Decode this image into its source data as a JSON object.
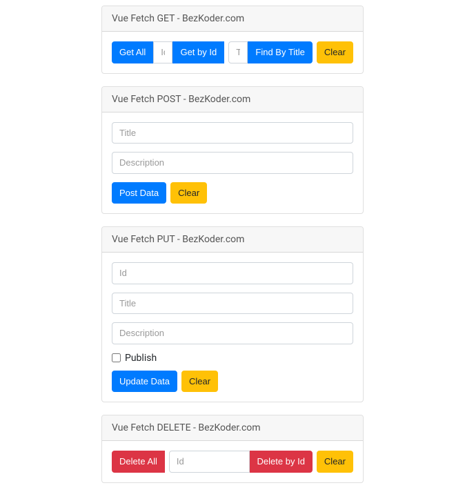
{
  "get": {
    "header": "Vue Fetch GET - BezKoder.com",
    "getAll": "Get All",
    "idPlaceholder": "Id",
    "getById": "Get by Id",
    "titlePlaceholder": "Title",
    "findByTitle": "Find By Title",
    "clear": "Clear"
  },
  "post": {
    "header": "Vue Fetch POST - BezKoder.com",
    "titlePlaceholder": "Title",
    "descPlaceholder": "Description",
    "postData": "Post Data",
    "clear": "Clear"
  },
  "put": {
    "header": "Vue Fetch PUT - BezKoder.com",
    "idPlaceholder": "Id",
    "titlePlaceholder": "Title",
    "descPlaceholder": "Description",
    "publishLabel": "Publish",
    "updateData": "Update Data",
    "clear": "Clear"
  },
  "del": {
    "header": "Vue Fetch DELETE - BezKoder.com",
    "deleteAll": "Delete All",
    "idPlaceholder": "Id",
    "deleteById": "Delete by Id",
    "clear": "Clear"
  }
}
